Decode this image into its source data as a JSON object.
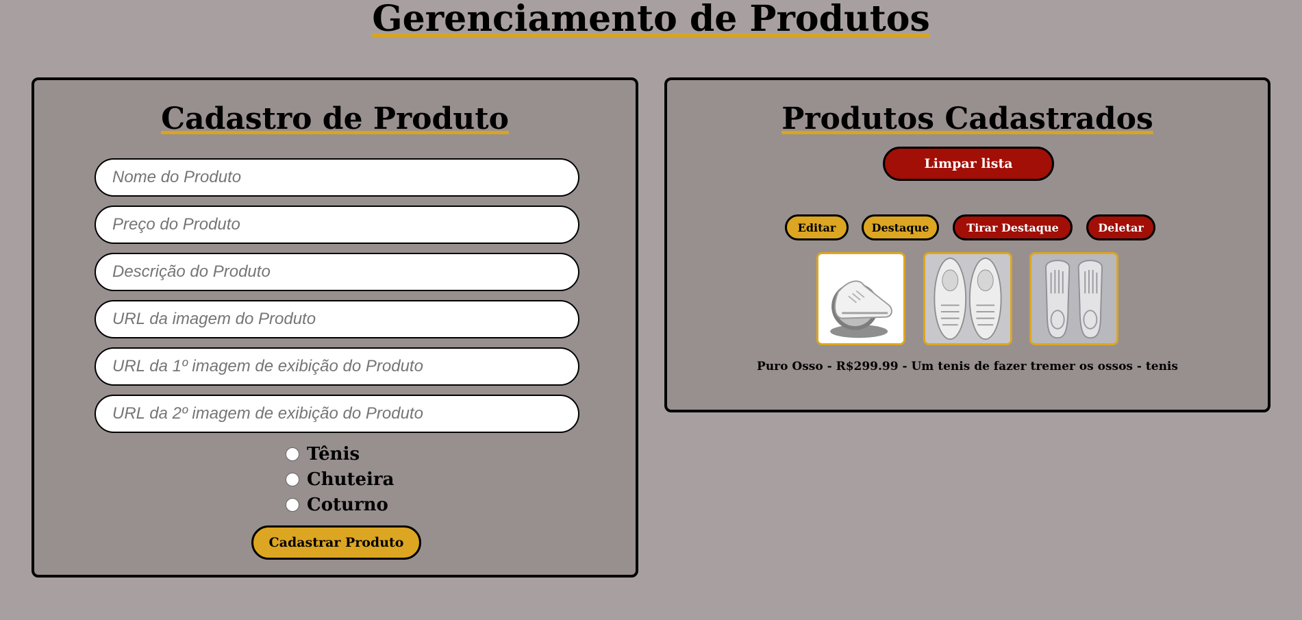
{
  "page": {
    "title": "Gerenciamento de Produtos"
  },
  "form": {
    "title": "Cadastro de Produto",
    "fields": [
      {
        "placeholder": "Nome do Produto",
        "value": ""
      },
      {
        "placeholder": "Preço do Produto",
        "value": ""
      },
      {
        "placeholder": "Descrição do Produto",
        "value": ""
      },
      {
        "placeholder": "URL da imagem do Produto",
        "value": ""
      },
      {
        "placeholder": "URL da 1º imagem de exibição do Produto",
        "value": ""
      },
      {
        "placeholder": "URL da 2º imagem de exibição do Produto",
        "value": ""
      }
    ],
    "categories": [
      {
        "label": "Tênis",
        "checked": false
      },
      {
        "label": "Chuteira",
        "checked": false
      },
      {
        "label": "Coturno",
        "checked": false
      }
    ],
    "submit_label": "Cadastrar Produto"
  },
  "list": {
    "title": "Produtos Cadastrados",
    "clear_label": "Limpar lista",
    "actions": {
      "edit": "Editar",
      "feature": "Destaque",
      "unfeature": "Tirar Destaque",
      "delete": "Deletar"
    },
    "product": {
      "images": [
        "shoe-side-image",
        "shoe-top-image",
        "shoe-sole-image"
      ],
      "line": "Puro Osso - R$299.99 - Um tenis de fazer tremer os ossos - tenis"
    }
  },
  "colors": {
    "background": "#a8a0a0",
    "panel": "#988f8f",
    "accent_gold": "#dca622",
    "accent_red": "#a10f07"
  }
}
